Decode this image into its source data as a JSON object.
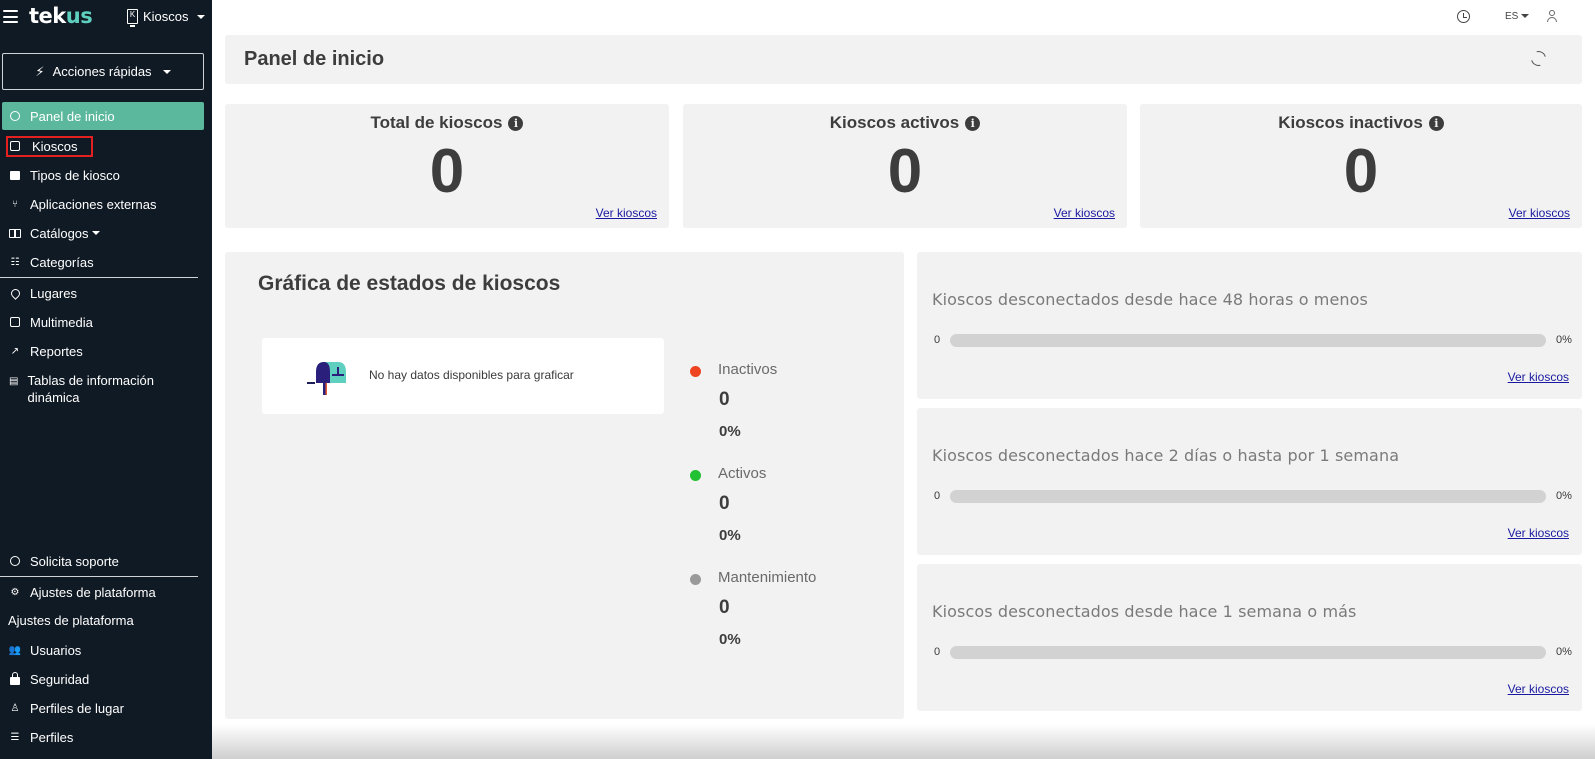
{
  "sidebar": {
    "logo_main": "tek",
    "logo_accent": "us",
    "app_switch_letter": "K",
    "app_switch_label": "Kioscos",
    "quick_actions": "Acciones rápidas",
    "items": [
      {
        "label": "Panel de inicio",
        "icon": "dashboard-icon"
      },
      {
        "label": "Kioscos",
        "icon": "kiosk-icon"
      },
      {
        "label": "Tipos de kiosco",
        "icon": "kiosk-type-icon"
      },
      {
        "label": "Aplicaciones externas",
        "icon": "external-apps-icon"
      },
      {
        "label": "Catálogos",
        "icon": "book-icon"
      },
      {
        "label": "Categorías",
        "icon": "categories-icon"
      },
      {
        "label": "Lugares",
        "icon": "location-pin-icon"
      },
      {
        "label": "Multimedia",
        "icon": "multimedia-icon"
      },
      {
        "label": "Reportes",
        "icon": "chart-line-icon"
      },
      {
        "label": "Tablas de información dinámica",
        "icon": "table-icon"
      }
    ],
    "support": "Solicita soporte",
    "settings_menu": "Ajustes de plataforma",
    "settings_header": "Ajustes de plataforma",
    "settings_items": [
      {
        "label": "Usuarios",
        "icon": "users-icon"
      },
      {
        "label": "Seguridad",
        "icon": "lock-icon"
      },
      {
        "label": "Perfiles de lugar",
        "icon": "place-profile-icon"
      },
      {
        "label": "Perfiles",
        "icon": "profiles-icon"
      }
    ]
  },
  "topbar": {
    "lang": "ES"
  },
  "header": {
    "title": "Panel de inicio"
  },
  "stats": [
    {
      "title": "Total de kioscos",
      "value": "0",
      "link": "Ver kioscos"
    },
    {
      "title": "Kioscos activos",
      "value": "0",
      "link": "Ver kioscos"
    },
    {
      "title": "Kioscos inactivos",
      "value": "0",
      "link": "Ver kioscos"
    }
  ],
  "chart": {
    "title": "Gráfica de estados de kioscos",
    "empty_message": "No hay datos disponibles para graficar",
    "legend": [
      {
        "label": "Inactivos",
        "count": "0",
        "pct": "0%",
        "color": "#ee4422"
      },
      {
        "label": "Activos",
        "count": "0",
        "pct": "0%",
        "color": "#22c033"
      },
      {
        "label": "Mantenimiento",
        "count": "0",
        "pct": "0%",
        "color": "#999999"
      }
    ]
  },
  "disconnected": [
    {
      "title": "Kioscos desconectados desde hace 48 horas o menos",
      "left": "0",
      "right": "0%",
      "progress": 0,
      "link": "Ver kioscos"
    },
    {
      "title": "Kioscos desconectados hace 2 días o hasta por 1 semana",
      "left": "0",
      "right": "0%",
      "progress": 0,
      "link": "Ver kioscos"
    },
    {
      "title": "Kioscos desconectados desde hace 1 semana o más",
      "left": "0",
      "right": "0%",
      "progress": 0,
      "link": "Ver kioscos"
    }
  ],
  "colors": {
    "sidebar_bg": "#101a24",
    "active_nav": "#5cb89d",
    "brand_accent": "#5fd0c0",
    "highlight_box": "#e52020"
  }
}
